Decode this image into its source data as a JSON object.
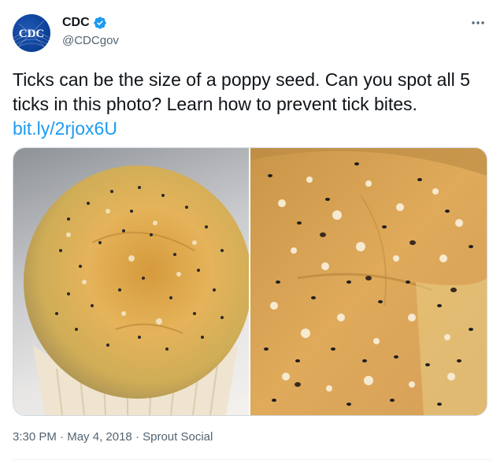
{
  "author": {
    "name": "CDC",
    "handle": "@CDCgov",
    "avatar_text": "CDC",
    "verified": true
  },
  "tweet": {
    "text": "Ticks can be the size of a poppy seed. Can you spot all 5 ticks in this photo? Learn how to prevent tick bites.",
    "link": "bit.ly/2rjox6U"
  },
  "media": {
    "images": [
      {
        "icon": "poppy-seed-muffin-image"
      },
      {
        "icon": "poppy-seed-muffin-closeup-image"
      }
    ]
  },
  "meta": {
    "time": "3:30 PM",
    "sep1": " · ",
    "date": "May 4, 2018",
    "sep2": " · ",
    "source": "Sprout Social"
  },
  "colors": {
    "link": "#1d9bf0",
    "secondary_text": "#536471",
    "verified": "#1d9bf0",
    "cdc_blue": "#0b3f96"
  }
}
